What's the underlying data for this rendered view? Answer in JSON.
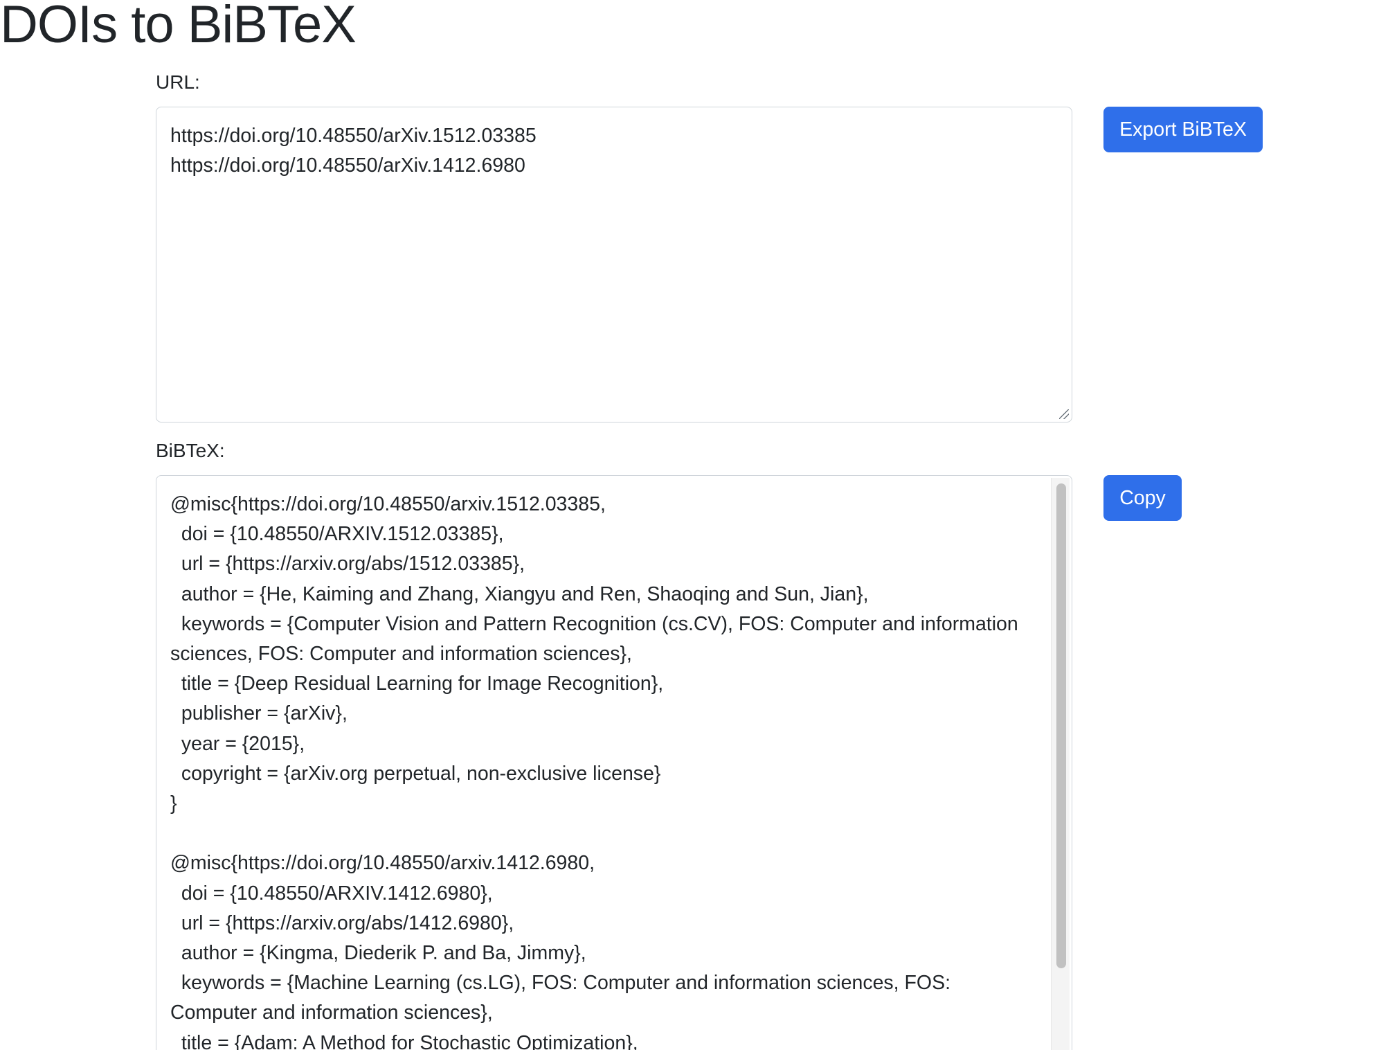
{
  "page": {
    "title": "DOIs to BiBTeX"
  },
  "url_section": {
    "label": "URL:",
    "value": "https://doi.org/10.48550/arXiv.1512.03385\nhttps://doi.org/10.48550/arXiv.1412.6980"
  },
  "export_button": {
    "label": "Export BiBTeX"
  },
  "bibtex_section": {
    "label": "BiBTeX:",
    "value": "@misc{https://doi.org/10.48550/arxiv.1512.03385,\n  doi = {10.48550/ARXIV.1512.03385},\n  url = {https://arxiv.org/abs/1512.03385},\n  author = {He, Kaiming and Zhang, Xiangyu and Ren, Shaoqing and Sun, Jian},\n  keywords = {Computer Vision and Pattern Recognition (cs.CV), FOS: Computer and information sciences, FOS: Computer and information sciences},\n  title = {Deep Residual Learning for Image Recognition},\n  publisher = {arXiv},\n  year = {2015},\n  copyright = {arXiv.org perpetual, non-exclusive license}\n}\n\n@misc{https://doi.org/10.48550/arxiv.1412.6980,\n  doi = {10.48550/ARXIV.1412.6980},\n  url = {https://arxiv.org/abs/1412.6980},\n  author = {Kingma, Diederik P. and Ba, Jimmy},\n  keywords = {Machine Learning (cs.LG), FOS: Computer and information sciences, FOS: Computer and information sciences},\n  title = {Adam: A Method for Stochastic Optimization},"
  },
  "copy_button": {
    "label": "Copy"
  },
  "colors": {
    "primary_button": "#2f6fea",
    "text": "#212529",
    "border": "#ced4da"
  }
}
